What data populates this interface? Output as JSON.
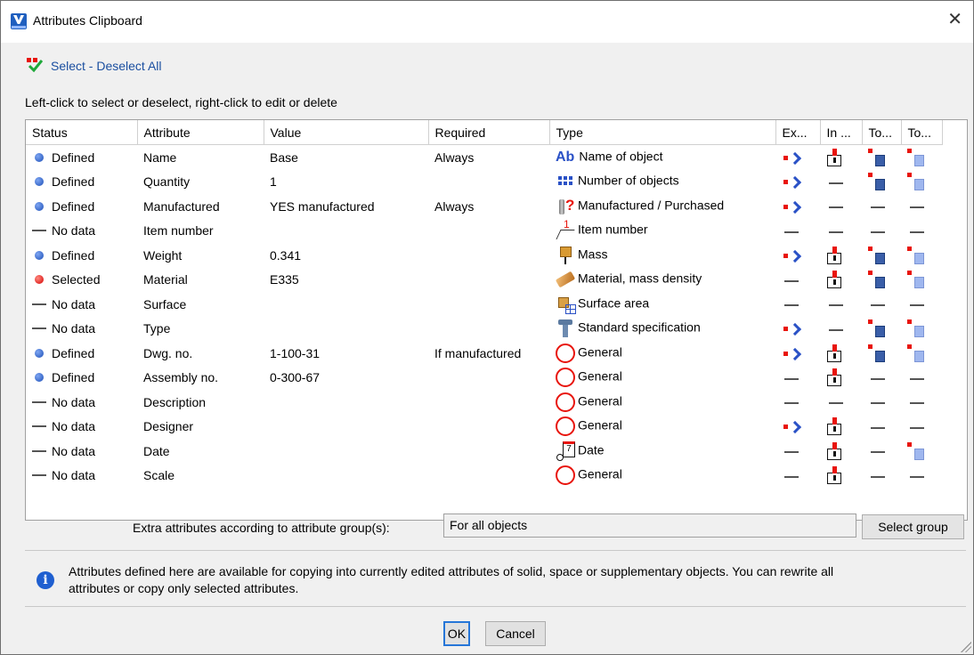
{
  "window": {
    "title": "Attributes Clipboard",
    "close_glyph": "✕"
  },
  "select_all_label": "Select - Deselect All",
  "hint": "Left-click to select or deselect, right-click to edit or delete",
  "columns": [
    "Status",
    "Attribute",
    "Value",
    "Required",
    "Type",
    "Ex...",
    "In ...",
    "To...",
    "To..."
  ],
  "rows": [
    {
      "status": "Defined",
      "indicator": "blue",
      "attribute": "Name",
      "value": "Base",
      "required": "Always",
      "type_icon": "ab",
      "type": "Name of object",
      "ex": "arrow",
      "in": "import",
      "to1": "to",
      "to2": "to-light"
    },
    {
      "status": "Defined",
      "indicator": "blue",
      "attribute": "Quantity",
      "value": "1",
      "required": "",
      "type_icon": "num",
      "type": "Number of objects",
      "ex": "arrow",
      "in": "none",
      "to1": "to",
      "to2": "to-light"
    },
    {
      "status": "Defined",
      "indicator": "blue",
      "attribute": "Manufactured",
      "value": "YES manufactured",
      "required": "Always",
      "type_icon": "wrench",
      "type": "Manufactured / Purchased",
      "ex": "arrow",
      "in": "none",
      "to1": "none",
      "to2": "none"
    },
    {
      "status": "No data",
      "indicator": "none",
      "attribute": "Item number",
      "value": "",
      "required": "",
      "type_icon": "item1",
      "type": "Item number",
      "ex": "none",
      "in": "none",
      "to1": "none",
      "to2": "none"
    },
    {
      "status": "Defined",
      "indicator": "blue",
      "attribute": "Weight",
      "value": "0.341",
      "required": "",
      "type_icon": "mass",
      "type": "Mass",
      "ex": "arrow",
      "in": "import",
      "to1": "to",
      "to2": "to-light"
    },
    {
      "status": "Selected",
      "indicator": "red",
      "attribute": "Material",
      "value": "E335",
      "required": "",
      "type_icon": "material",
      "type": "Material, mass density",
      "ex": "none",
      "in": "import",
      "to1": "to",
      "to2": "to-light"
    },
    {
      "status": "No data",
      "indicator": "none",
      "attribute": "Surface",
      "value": "",
      "required": "",
      "type_icon": "surface",
      "type": "Surface area",
      "ex": "none",
      "in": "none",
      "to1": "none",
      "to2": "none"
    },
    {
      "status": "No data",
      "indicator": "none",
      "attribute": "Type",
      "value": "",
      "required": "",
      "type_icon": "standard",
      "type": "Standard specification",
      "ex": "arrow",
      "in": "none",
      "to1": "to",
      "to2": "to-light"
    },
    {
      "status": "Defined",
      "indicator": "blue",
      "attribute": "Dwg. no.",
      "value": "1-100-31",
      "required": "If manufactured",
      "type_icon": "general",
      "type": "General",
      "ex": "arrow",
      "in": "import",
      "to1": "to",
      "to2": "to-light"
    },
    {
      "status": "Defined",
      "indicator": "blue",
      "attribute": "Assembly no.",
      "value": "0-300-67",
      "required": "",
      "type_icon": "general",
      "type": "General",
      "ex": "none",
      "in": "import",
      "to1": "none",
      "to2": "none"
    },
    {
      "status": "No data",
      "indicator": "none",
      "attribute": "Description",
      "value": "",
      "required": "",
      "type_icon": "general",
      "type": "General",
      "ex": "none",
      "in": "none",
      "to1": "none",
      "to2": "none"
    },
    {
      "status": "No data",
      "indicator": "none",
      "attribute": "Designer",
      "value": "",
      "required": "",
      "type_icon": "general",
      "type": "General",
      "ex": "arrow",
      "in": "import",
      "to1": "none",
      "to2": "none"
    },
    {
      "status": "No data",
      "indicator": "none",
      "attribute": "Date",
      "value": "",
      "required": "",
      "type_icon": "date",
      "type": "Date",
      "ex": "none",
      "in": "import",
      "to1": "none",
      "to2": "to-light"
    },
    {
      "status": "No data",
      "indicator": "none",
      "attribute": "Scale",
      "value": "",
      "required": "",
      "type_icon": "general",
      "type": "General",
      "ex": "none",
      "in": "import",
      "to1": "none",
      "to2": "none"
    }
  ],
  "extra": {
    "label": "Extra attributes according to attribute group(s):",
    "value": "For all objects",
    "button": "Select group"
  },
  "info": "Attributes defined here are available for copying into currently edited attributes of solid, space or supplementary objects. You can rewrite all attributes or copy only selected attributes.",
  "buttons": {
    "ok": "OK",
    "cancel": "Cancel"
  }
}
